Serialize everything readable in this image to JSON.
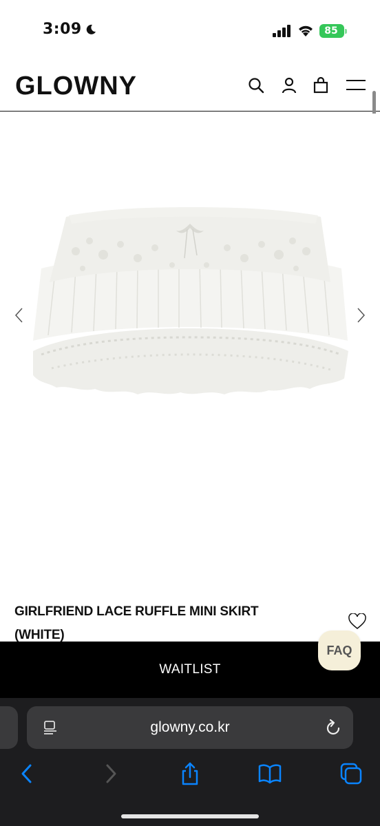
{
  "status_bar": {
    "time": "3:09",
    "battery": "85"
  },
  "header": {
    "logo": "GLOWNY"
  },
  "icons": {
    "search": "search-icon",
    "account": "user-icon",
    "cart": "bag-icon",
    "menu": "hamburger-icon",
    "prev": "chevron-left-icon",
    "next": "chevron-right-icon",
    "wishlist": "heart-icon"
  },
  "product": {
    "title": "GIRLFRIEND LACE RUFFLE MINI SKIRT (WHITE)",
    "image_subject": "white lace ruffle mini skirt"
  },
  "buttons": {
    "waitlist": "WAITLIST",
    "faq": "FAQ"
  },
  "browser": {
    "url": "glowny.co.kr",
    "toolbar": [
      "back",
      "forward",
      "share",
      "bookmarks",
      "tabs"
    ]
  },
  "colors": {
    "accent_battery": "#35c759",
    "faq_bg": "#f5efd9",
    "safari_bg": "#1d1d1f",
    "toolbar_blue": "#0a84ff"
  }
}
